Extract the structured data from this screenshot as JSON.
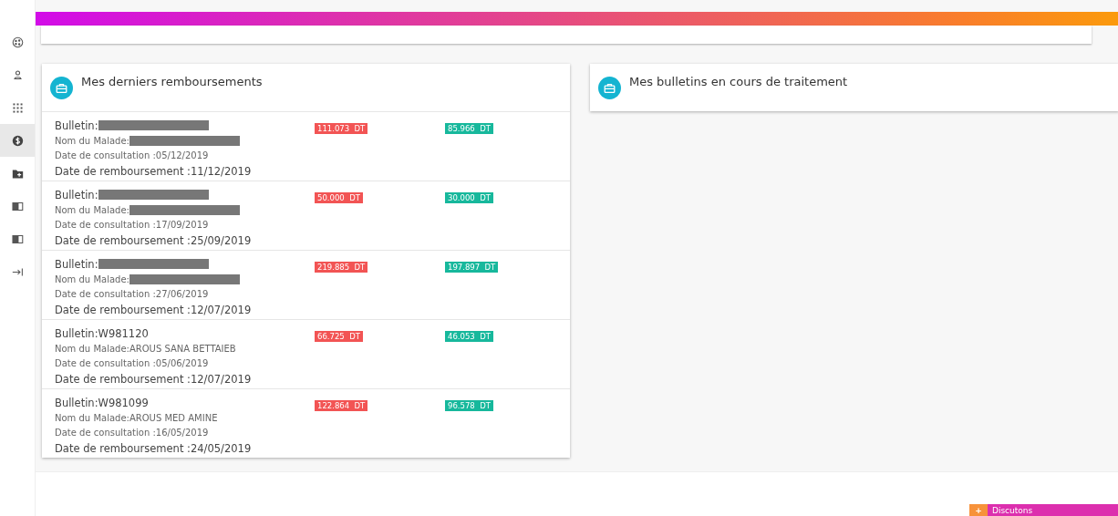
{
  "sidebar": {
    "items": [
      {
        "kind": "palette",
        "selected": false
      },
      {
        "kind": "user",
        "selected": false
      },
      {
        "kind": "grid",
        "selected": false
      },
      {
        "kind": "dollar",
        "selected": true
      },
      {
        "kind": "folder-plus",
        "selected": false
      },
      {
        "kind": "book",
        "selected": false
      },
      {
        "kind": "book",
        "selected": false
      },
      {
        "kind": "logout",
        "selected": false
      }
    ]
  },
  "cards": [
    {
      "title": "Mes derniers remboursements",
      "rows": [
        {
          "bulletin": {
            "label": "Bulletin:",
            "redacted": true
          },
          "patient": {
            "label": "Nom du Malade:",
            "redacted": true
          },
          "consultation": "Date de consultation :05/12/2019",
          "reimbursement": "Date de remboursement :11/12/2019",
          "amount": "111.073  DT",
          "refund": "85.966  DT"
        },
        {
          "bulletin": {
            "label": "Bulletin:",
            "redacted": true
          },
          "patient": {
            "label": "Nom du Malade:",
            "redacted": true
          },
          "consultation": "Date de consultation :17/09/2019",
          "reimbursement": "Date de remboursement :25/09/2019",
          "amount": "50.000  DT",
          "refund": "30.000  DT"
        },
        {
          "bulletin": {
            "label": "Bulletin:",
            "redacted": true
          },
          "patient": {
            "label": "Nom du Malade:",
            "redacted": true
          },
          "consultation": "Date de consultation :27/06/2019",
          "reimbursement": "Date de remboursement :12/07/2019",
          "amount": "219.885  DT",
          "refund": "197.897  DT"
        },
        {
          "bulletin": {
            "label": "Bulletin:",
            "value": "W981120",
            "redacted": false
          },
          "patient": {
            "label": "Nom du Malade:",
            "value": "AROUS SANA BETTAIEB",
            "redacted": false
          },
          "consultation": "Date de consultation :05/06/2019",
          "reimbursement": "Date de remboursement :12/07/2019",
          "amount": "66.725  DT",
          "refund": "46.053  DT"
        },
        {
          "bulletin": {
            "label": "Bulletin:",
            "value": "W981099",
            "redacted": false
          },
          "patient": {
            "label": "Nom du Malade:",
            "value": "AROUS MED AMINE",
            "redacted": false
          },
          "consultation": "Date de consultation :16/05/2019",
          "reimbursement": "Date de remboursement :24/05/2019",
          "amount": "122.864  DT",
          "refund": "96.578  DT"
        }
      ]
    },
    {
      "title": "Mes bulletins en cours de traitement"
    }
  ],
  "chat": {
    "icon": "+",
    "label": "Discutons"
  }
}
